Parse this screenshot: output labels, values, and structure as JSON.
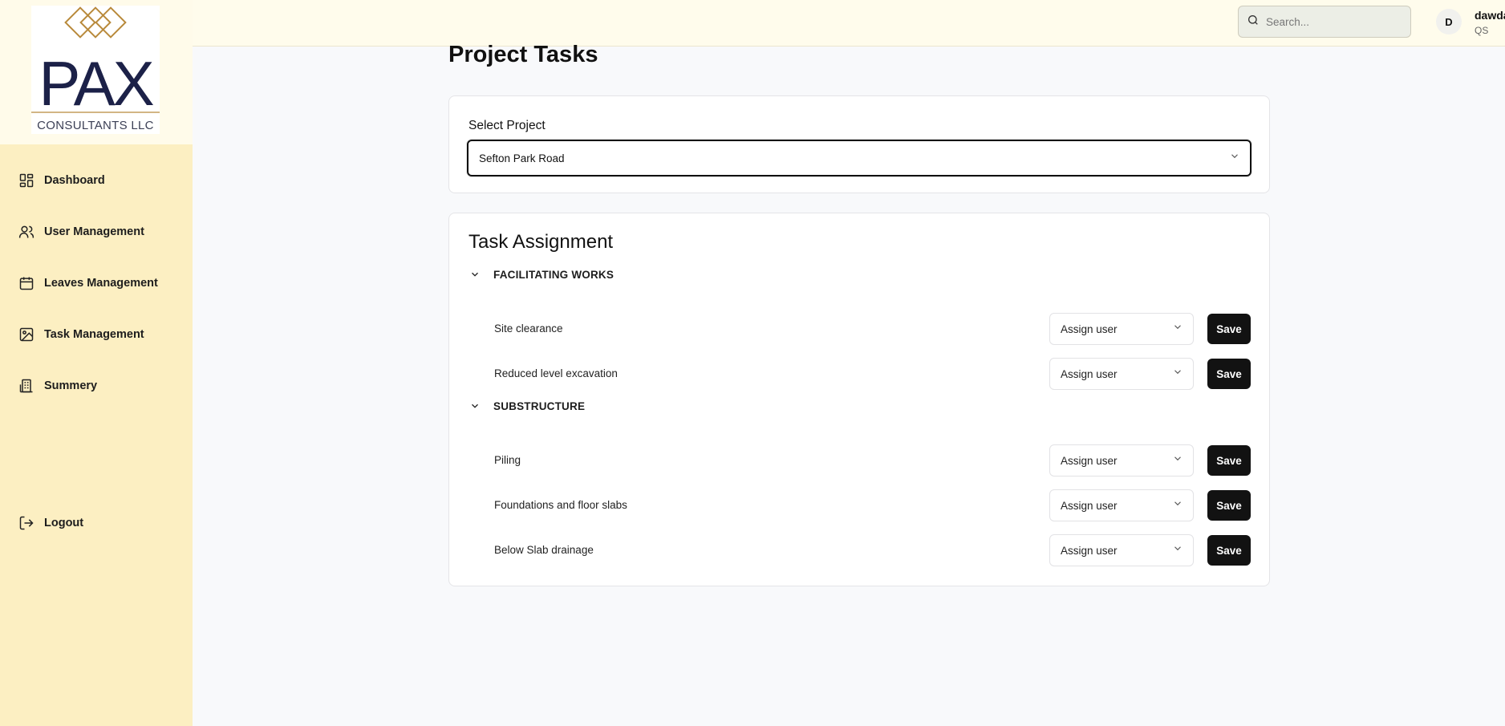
{
  "brand": {
    "logo_name": "PAX",
    "logo_sub": "CONSULTANTS LLC"
  },
  "sidebar": {
    "items": [
      {
        "label": "Dashboard",
        "icon": "dashboard-icon"
      },
      {
        "label": "User Management",
        "icon": "users-icon"
      },
      {
        "label": "Leaves Management",
        "icon": "calendar-icon"
      },
      {
        "label": "Task Management",
        "icon": "image-icon"
      },
      {
        "label": "Summery",
        "icon": "building-icon"
      }
    ],
    "logout_label": "Logout"
  },
  "header": {
    "search_placeholder": "Search...",
    "avatar_initial": "D",
    "user_name": "dawda",
    "user_role": "QS"
  },
  "main": {
    "page_title": "Project Tasks",
    "select_label": "Select Project",
    "selected_project": "Sefton Park Road",
    "section_title": "Task Assignment",
    "assign_placeholder": "Assign user",
    "save_label": "Save",
    "groups": [
      {
        "name": "FACILITATING WORKS",
        "tasks": [
          "Site clearance",
          "Reduced level excavation"
        ]
      },
      {
        "name": "SUBSTRUCTURE",
        "tasks": [
          "Piling",
          "Foundations and floor slabs",
          "Below Slab drainage"
        ]
      }
    ]
  },
  "colors": {
    "sidebar_bg": "#fcefc2",
    "header_bg": "#fffcec",
    "button_bg": "#121212",
    "logo_navy": "#1c2148",
    "logo_gold": "#b8893a"
  }
}
